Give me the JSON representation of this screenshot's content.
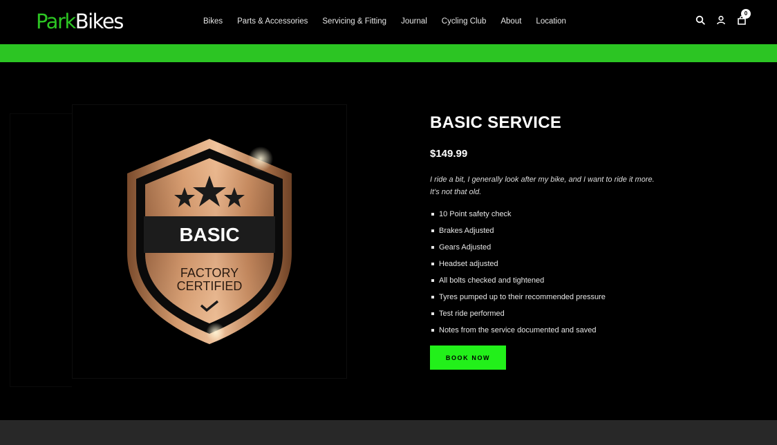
{
  "header": {
    "logo_park": "Park",
    "logo_bikes": "Bikes",
    "nav": [
      "Bikes",
      "Parts & Accessories",
      "Servicing & Fitting",
      "Journal",
      "Cycling Club",
      "About",
      "Location"
    ],
    "cart_count": "0",
    "icons": [
      "search-icon",
      "account-icon",
      "cart-icon"
    ]
  },
  "badge": {
    "label": "BASIC",
    "line1": "FACTORY",
    "line2": "CERTIFIED"
  },
  "product": {
    "title": "BASIC SERVICE",
    "price": "$149.99",
    "description": "I ride a bit, I generally look after my bike, and I want to ride it more. It's not that old.",
    "features": [
      "10 Point safety check",
      "Brakes Adjusted",
      "Gears Adjusted",
      "Headset adjusted",
      "All bolts checked and tightened",
      "Tyres pumped up to their recommended pressure",
      "Test ride performed",
      "Notes from the service documented and saved"
    ],
    "button": "BOOK NOW"
  },
  "colors": {
    "brand_green": "#2cc523",
    "button_green": "#22f01a",
    "background": "#000000",
    "bronze": "#c98a5c"
  }
}
